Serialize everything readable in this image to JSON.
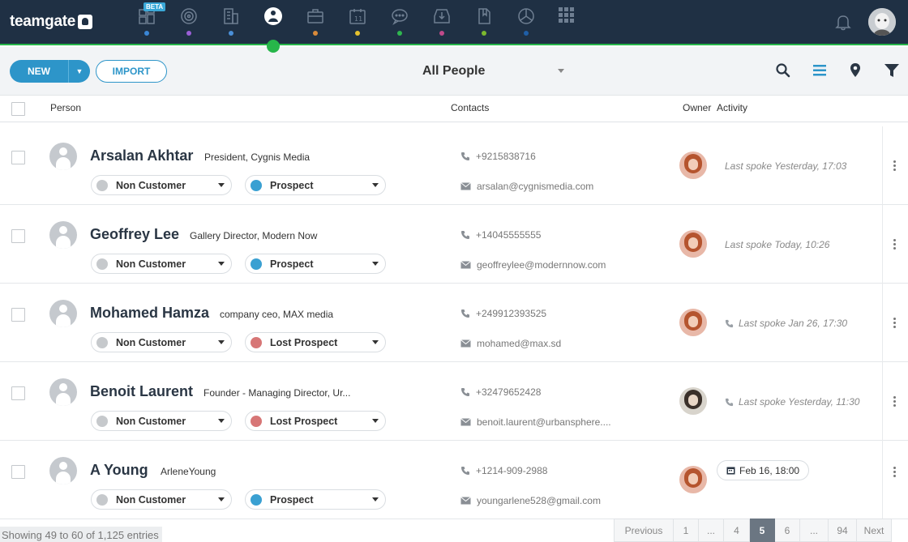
{
  "app": {
    "name": "teamgate"
  },
  "nav": {
    "beta_label": "BETA"
  },
  "colors": {
    "topbar": "#1f3044",
    "accent": "#2d95c9",
    "active": "#27b64a",
    "customer_status": "#c6c9cc",
    "prospect": "#3aa0d2",
    "lost_prospect": "#d77676"
  },
  "toolbar": {
    "new_label": "NEW",
    "import_label": "IMPORT",
    "view_title": "All People"
  },
  "columns": {
    "person": "Person",
    "contacts": "Contacts",
    "owner": "Owner",
    "activity": "Activity"
  },
  "rows": [
    {
      "name": "Arsalan Akhtar",
      "title": "President, Cygnis Media",
      "status": "Non Customer",
      "stage": "Prospect",
      "phone": "+9215838716",
      "email": "arsalan@cygnismedia.com",
      "activity": "Last spoke Yesterday, 17:03"
    },
    {
      "name": "Geoffrey Lee",
      "title": "Gallery Director, Modern Now",
      "status": "Non Customer",
      "stage": "Prospect",
      "phone": "+14045555555",
      "email": "geoffreylee@modernnow.com",
      "activity": "Last spoke Today, 10:26"
    },
    {
      "name": "Mohamed Hamza",
      "title": "company ceo, MAX media",
      "status": "Non Customer",
      "stage": "Lost Prospect",
      "phone": "+249912393525",
      "email": "mohamed@max.sd",
      "activity": "Last spoke Jan 26, 17:30"
    },
    {
      "name": "Benoit Laurent",
      "title": "Founder - Managing Director, Ur...",
      "status": "Non Customer",
      "stage": "Lost Prospect",
      "phone": "+32479652428",
      "email": "benoit.laurent@urbansphere....",
      "activity": "Last spoke Yesterday, 11:30"
    },
    {
      "name": "A Young",
      "title": "ArleneYoung",
      "status": "Non Customer",
      "stage": "Prospect",
      "phone": "+1214-909-2988",
      "email": "youngarlene528@gmail.com",
      "activity": "Feb 16, 18:00"
    }
  ],
  "footer": {
    "info": "Showing 49 to 60 of 1,125 entries"
  },
  "pagination": [
    "Previous",
    "1",
    "...",
    "4",
    "5",
    "6",
    "...",
    "94",
    "Next"
  ],
  "pagination_active": "5"
}
